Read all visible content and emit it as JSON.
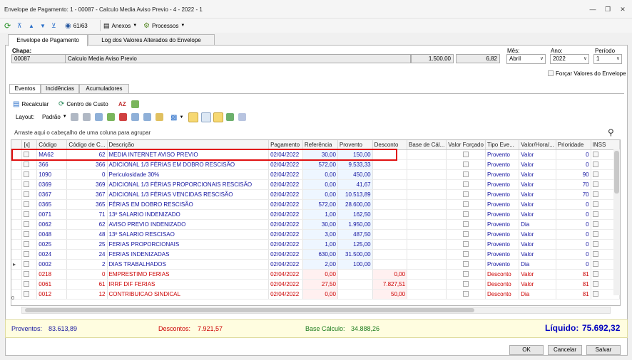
{
  "window": {
    "title": "Envelope de Pagamento: 1 - 00087 - Calculo Media Aviso Previo - 4 - 2022 - 1"
  },
  "toolbar": {
    "record_counter": "61/63",
    "attachments_label": "Anexos",
    "processes_label": "Processos"
  },
  "tabs": [
    "Envelope de Pagamento",
    "Log dos Valores Alterados do Envelope"
  ],
  "header": {
    "chapa_label": "Chapa:",
    "chapa_code": "00087",
    "chapa_name": "Calculo Media Aviso Previo",
    "value1": "1.500,00",
    "value2": "6,82",
    "mes_label": "Mês:",
    "mes_value": "Abril",
    "ano_label": "Ano:",
    "ano_value": "2022",
    "periodo_label": "Período",
    "periodo_value": "1",
    "force_label": "Forçar Valores do Envelope"
  },
  "subtabs": [
    "Eventos",
    "Incidências",
    "Acumuladores"
  ],
  "actions": {
    "recalc": "Recalcular",
    "cost_center": "Centro de Custo",
    "layout_label": "Layout:",
    "layout_value": "Padrão"
  },
  "group_hint": "Arraste aqui o cabeçalho de uma coluna para agrupar",
  "columns": [
    "[x]",
    "Código",
    "Código de C...",
    "Descrição",
    "Pagamento",
    "Referência",
    "Provento",
    "Desconto",
    "Base de Cál...",
    "Valor Forçado",
    "Tipo Eve...",
    "Valor/Hora/...",
    "Prioridade",
    "INSS"
  ],
  "rows": [
    {
      "codigo": "MA62",
      "codc": "62",
      "descricao": "MEDIA INTERNET AVISO PREVIO",
      "pagamento": "02/04/2022",
      "referencia": "30,00",
      "provento": "150,00",
      "desconto": "",
      "tipo": "Provento",
      "vh": "Valor",
      "prioridade": "0",
      "kind": "prov"
    },
    {
      "codigo": "366",
      "codc": "366",
      "descricao": "ADICIONAL 1/3 FÉRIAS EM DOBRO RESCISÃO",
      "pagamento": "02/04/2022",
      "referencia": "572,00",
      "provento": "9.533,33",
      "desconto": "",
      "tipo": "Provento",
      "vh": "Valor",
      "prioridade": "0",
      "kind": "prov"
    },
    {
      "codigo": "1090",
      "codc": "0",
      "descricao": "Periculosidade 30%",
      "pagamento": "02/04/2022",
      "referencia": "0,00",
      "provento": "450,00",
      "desconto": "",
      "tipo": "Provento",
      "vh": "Valor",
      "prioridade": "90",
      "kind": "prov"
    },
    {
      "codigo": "0369",
      "codc": "369",
      "descricao": "ADICIONAL 1/3 FÉRIAS PROPORCIONAIS RESCISÃO",
      "pagamento": "02/04/2022",
      "referencia": "0,00",
      "provento": "41,67",
      "desconto": "",
      "tipo": "Provento",
      "vh": "Valor",
      "prioridade": "70",
      "kind": "prov"
    },
    {
      "codigo": "0367",
      "codc": "367",
      "descricao": "ADICIONAL 1/3 FÉRIAS VENCIDAS RESCISÃO",
      "pagamento": "02/04/2022",
      "referencia": "0,00",
      "provento": "10.513,89",
      "desconto": "",
      "tipo": "Provento",
      "vh": "Valor",
      "prioridade": "70",
      "kind": "prov"
    },
    {
      "codigo": "0365",
      "codc": "365",
      "descricao": "FÉRIAS EM DOBRO RESCISÃO",
      "pagamento": "02/04/2022",
      "referencia": "572,00",
      "provento": "28.600,00",
      "desconto": "",
      "tipo": "Provento",
      "vh": "Valor",
      "prioridade": "0",
      "kind": "prov"
    },
    {
      "codigo": "0071",
      "codc": "71",
      "descricao": "13º SALARIO INDENIZADO",
      "pagamento": "02/04/2022",
      "referencia": "1,00",
      "provento": "162,50",
      "desconto": "",
      "tipo": "Provento",
      "vh": "Valor",
      "prioridade": "0",
      "kind": "prov"
    },
    {
      "codigo": "0062",
      "codc": "62",
      "descricao": "AVISO PREVIO INDENIZADO",
      "pagamento": "02/04/2022",
      "referencia": "30,00",
      "provento": "1.950,00",
      "desconto": "",
      "tipo": "Provento",
      "vh": "Dia",
      "prioridade": "0",
      "kind": "prov"
    },
    {
      "codigo": "0048",
      "codc": "48",
      "descricao": "13º SALARIO RESCISAO",
      "pagamento": "02/04/2022",
      "referencia": "3,00",
      "provento": "487,50",
      "desconto": "",
      "tipo": "Provento",
      "vh": "Valor",
      "prioridade": "0",
      "kind": "prov"
    },
    {
      "codigo": "0025",
      "codc": "25",
      "descricao": "FERIAS PROPORCIONAIS",
      "pagamento": "02/04/2022",
      "referencia": "1,00",
      "provento": "125,00",
      "desconto": "",
      "tipo": "Provento",
      "vh": "Valor",
      "prioridade": "0",
      "kind": "prov"
    },
    {
      "codigo": "0024",
      "codc": "24",
      "descricao": "FERIAS INDENIZADAS",
      "pagamento": "02/04/2022",
      "referencia": "630,00",
      "provento": "31.500,00",
      "desconto": "",
      "tipo": "Provento",
      "vh": "Valor",
      "prioridade": "0",
      "kind": "prov"
    },
    {
      "codigo": "0002",
      "codc": "2",
      "descricao": "DIAS TRABALHADOS",
      "pagamento": "02/04/2022",
      "referencia": "2,00",
      "provento": "100,00",
      "desconto": "",
      "tipo": "Provento",
      "vh": "Dia",
      "prioridade": "0",
      "kind": "prov"
    },
    {
      "codigo": "0218",
      "codc": "0",
      "descricao": "EMPRESTIMO FERIAS",
      "pagamento": "02/04/2022",
      "referencia": "0,00",
      "provento": "",
      "desconto": "0,00",
      "tipo": "Desconto",
      "vh": "Valor",
      "prioridade": "81",
      "kind": "desc"
    },
    {
      "codigo": "0061",
      "codc": "61",
      "descricao": "IRRF DIF FERIAS",
      "pagamento": "02/04/2022",
      "referencia": "27,50",
      "provento": "",
      "desconto": "7.827,51",
      "tipo": "Desconto",
      "vh": "Valor",
      "prioridade": "81",
      "kind": "desc"
    },
    {
      "codigo": "0012",
      "codc": "12",
      "descricao": "CONTRIBUICAO SINDICAL",
      "pagamento": "02/04/2022",
      "referencia": "0,00",
      "provento": "",
      "desconto": "50,00",
      "tipo": "Desconto",
      "vh": "Dia",
      "prioridade": "81",
      "kind": "desc"
    }
  ],
  "grid_footer": {
    "count": "0"
  },
  "totals": {
    "proventos_label": "Proventos:",
    "proventos_value": "83.613,89",
    "descontos_label": "Descontos:",
    "descontos_value": "7.921,57",
    "base_label": "Base Cálculo:",
    "base_value": "34.888,26",
    "liquido_label": "Líquido:",
    "liquido_value": "75.692,32"
  },
  "buttons": {
    "ok": "OK",
    "cancel": "Cancelar",
    "save": "Salvar"
  },
  "colors": {
    "provento": "#1515a0",
    "desconto": "#cc0000",
    "highlight": "#e01010",
    "liquido": "#0000c0"
  }
}
